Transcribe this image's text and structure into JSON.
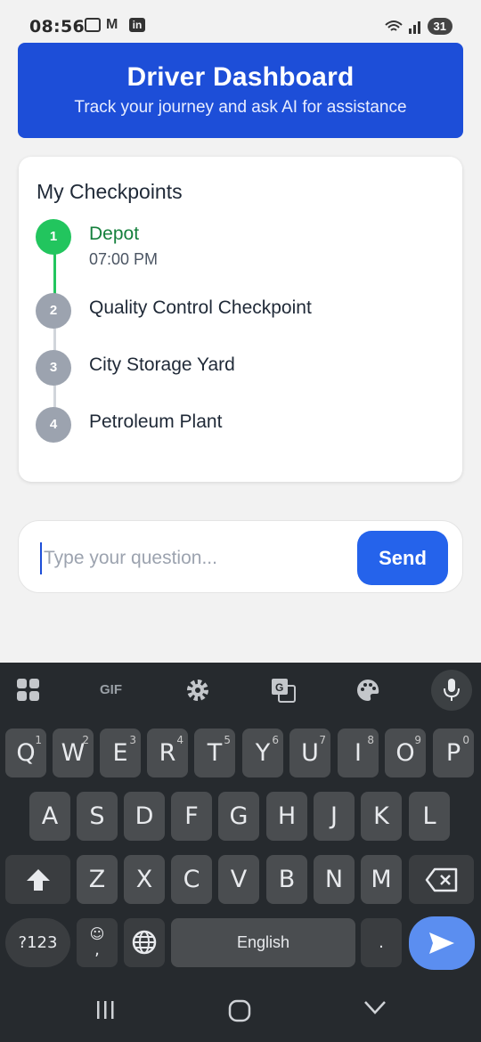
{
  "status_bar": {
    "time": "08:56",
    "battery": "31"
  },
  "header": {
    "title": "Driver Dashboard",
    "subtitle": "Track your journey and ask AI for assistance"
  },
  "checkpoints": {
    "title": "My Checkpoints",
    "items": [
      {
        "number": "1",
        "name": "Depot",
        "time": "07:00 PM",
        "status": "completed"
      },
      {
        "number": "2",
        "name": "Quality Control Checkpoint",
        "time": "",
        "status": "pending"
      },
      {
        "number": "3",
        "name": "City Storage Yard",
        "time": "",
        "status": "pending"
      },
      {
        "number": "4",
        "name": "Petroleum Plant",
        "time": "",
        "status": "pending"
      }
    ]
  },
  "ask": {
    "placeholder": "Type your question...",
    "send_label": "Send"
  },
  "keyboard": {
    "toolbar": [
      "apps-icon",
      "gif-icon",
      "settings-icon",
      "translate-icon",
      "palette-icon",
      "mic-icon"
    ],
    "gif_label": "GIF",
    "row1": [
      "Q",
      "W",
      "E",
      "R",
      "T",
      "Y",
      "U",
      "I",
      "O",
      "P"
    ],
    "row1_hints": [
      "1",
      "2",
      "3",
      "4",
      "5",
      "6",
      "7",
      "8",
      "9",
      "0"
    ],
    "row2": [
      "A",
      "S",
      "D",
      "F",
      "G",
      "H",
      "J",
      "K",
      "L"
    ],
    "row3": [
      "Z",
      "X",
      "C",
      "V",
      "B",
      "N",
      "M"
    ],
    "symbols_label": "?123",
    "emoji_label": "☺",
    "comma_label": ",",
    "space_label": "English",
    "period_label": "."
  },
  "colors": {
    "accent": "#1d4ed8",
    "send": "#2563eb",
    "completed": "#22c55e",
    "completed_text": "#15803d",
    "pending": "#9ca3af"
  }
}
